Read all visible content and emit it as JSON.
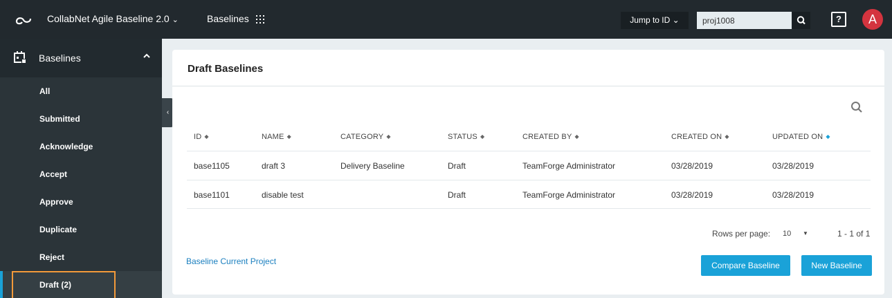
{
  "topbar": {
    "app_title": "CollabNet Agile Baseline 2.0",
    "module": "Baselines",
    "jump_label": "Jump to ID",
    "project_value": "proj1008",
    "help_label": "?",
    "avatar_initial": "A"
  },
  "sidebar": {
    "section_title": "Baselines",
    "items": [
      {
        "label": "All"
      },
      {
        "label": "Submitted"
      },
      {
        "label": "Acknowledge"
      },
      {
        "label": "Accept"
      },
      {
        "label": "Approve"
      },
      {
        "label": "Duplicate"
      },
      {
        "label": "Reject"
      },
      {
        "label": "Draft (2)"
      }
    ],
    "active_index": 7
  },
  "main": {
    "title": "Draft Baselines",
    "columns": [
      "ID",
      "NAME",
      "CATEGORY",
      "STATUS",
      "CREATED BY",
      "CREATED ON",
      "UPDATED ON"
    ],
    "rows": [
      [
        "base1105",
        "draft 3",
        "Delivery Baseline",
        "Draft",
        "TeamForge Administrator",
        "03/28/2019",
        "03/28/2019"
      ],
      [
        "base1101",
        "disable test",
        "",
        "Draft",
        "TeamForge Administrator",
        "03/28/2019",
        "03/28/2019"
      ]
    ],
    "rows_per_page_label": "Rows per page:",
    "rows_per_page_value": "10",
    "pagination": "1 - 1 of 1",
    "link_label": "Baseline Current Project",
    "compare_button": "Compare Baseline",
    "new_button": "New Baseline"
  },
  "colors": {
    "accent": "#1aa2d8",
    "topbar_bg": "#22292e",
    "sidebar_bg": "#2b3439",
    "highlight": "#f39a3a",
    "avatar": "#d4343f"
  }
}
